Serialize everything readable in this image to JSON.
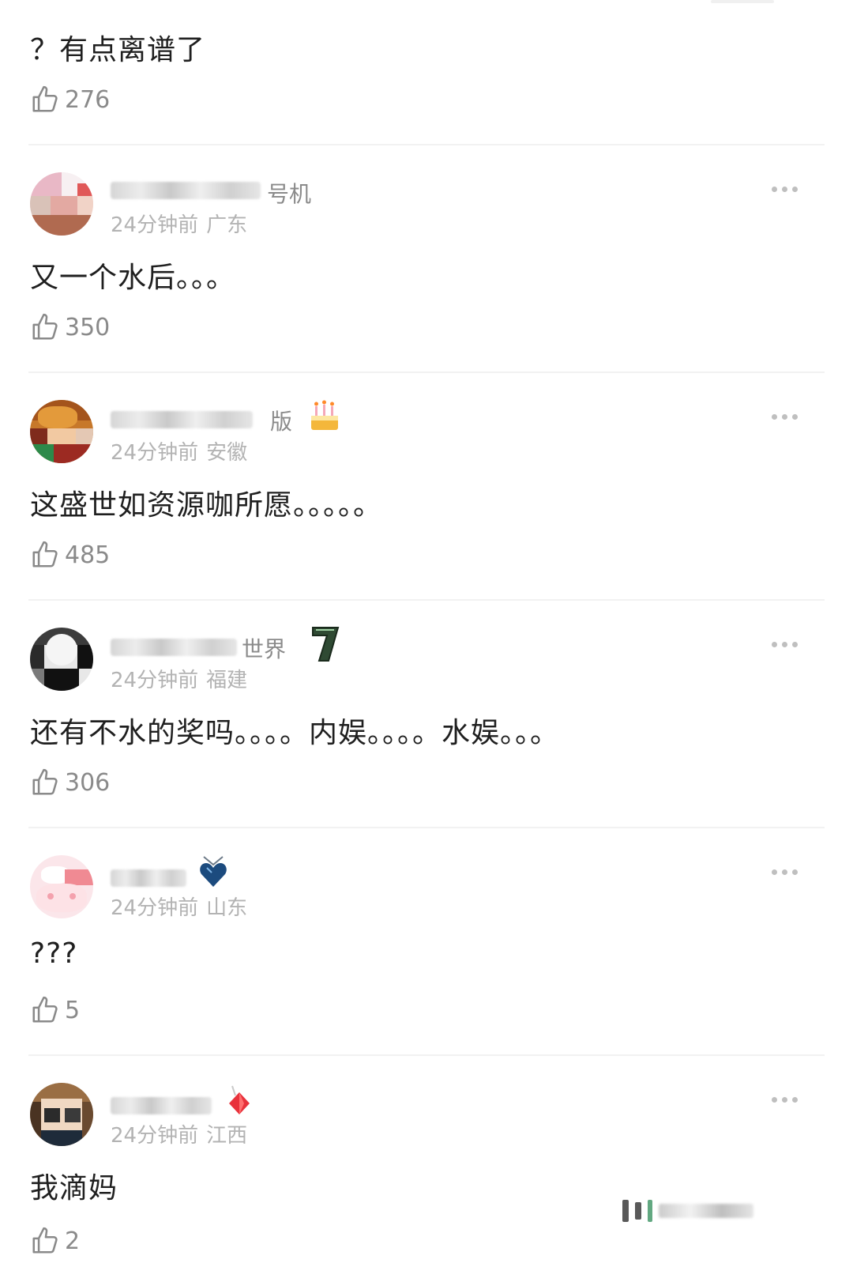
{
  "more_icon": "more-dots-icon",
  "like_icon": "thumbs-up-icon",
  "comments": [
    {
      "name_suffix": "",
      "time": "",
      "location": "",
      "content": "？有点离谱了",
      "likes": "276"
    },
    {
      "name_suffix": "号机",
      "time": "24分钟前",
      "location": "广东",
      "content": "又一个水后。。。",
      "likes": "350"
    },
    {
      "name_suffix": "版",
      "time": "24分钟前",
      "location": "安徽",
      "content": "这盛世如资源咖所愿。。。。。",
      "likes": "485",
      "badge": "cake-icon"
    },
    {
      "name_suffix": "世界",
      "time": "24分钟前",
      "location": "福建",
      "content": "还有不水的奖吗。。。。内娱。。。。水娱。。。",
      "likes": "306",
      "badge": "level-7-icon"
    },
    {
      "name_suffix": "",
      "time": "24分钟前",
      "location": "山东",
      "content": "???",
      "likes": "5",
      "badge": "heart-gem-icon"
    },
    {
      "name_suffix": "",
      "time": "24分钟前",
      "location": "江西",
      "content": "我滴妈",
      "likes": "2",
      "badge": "red-diamond-icon"
    }
  ]
}
